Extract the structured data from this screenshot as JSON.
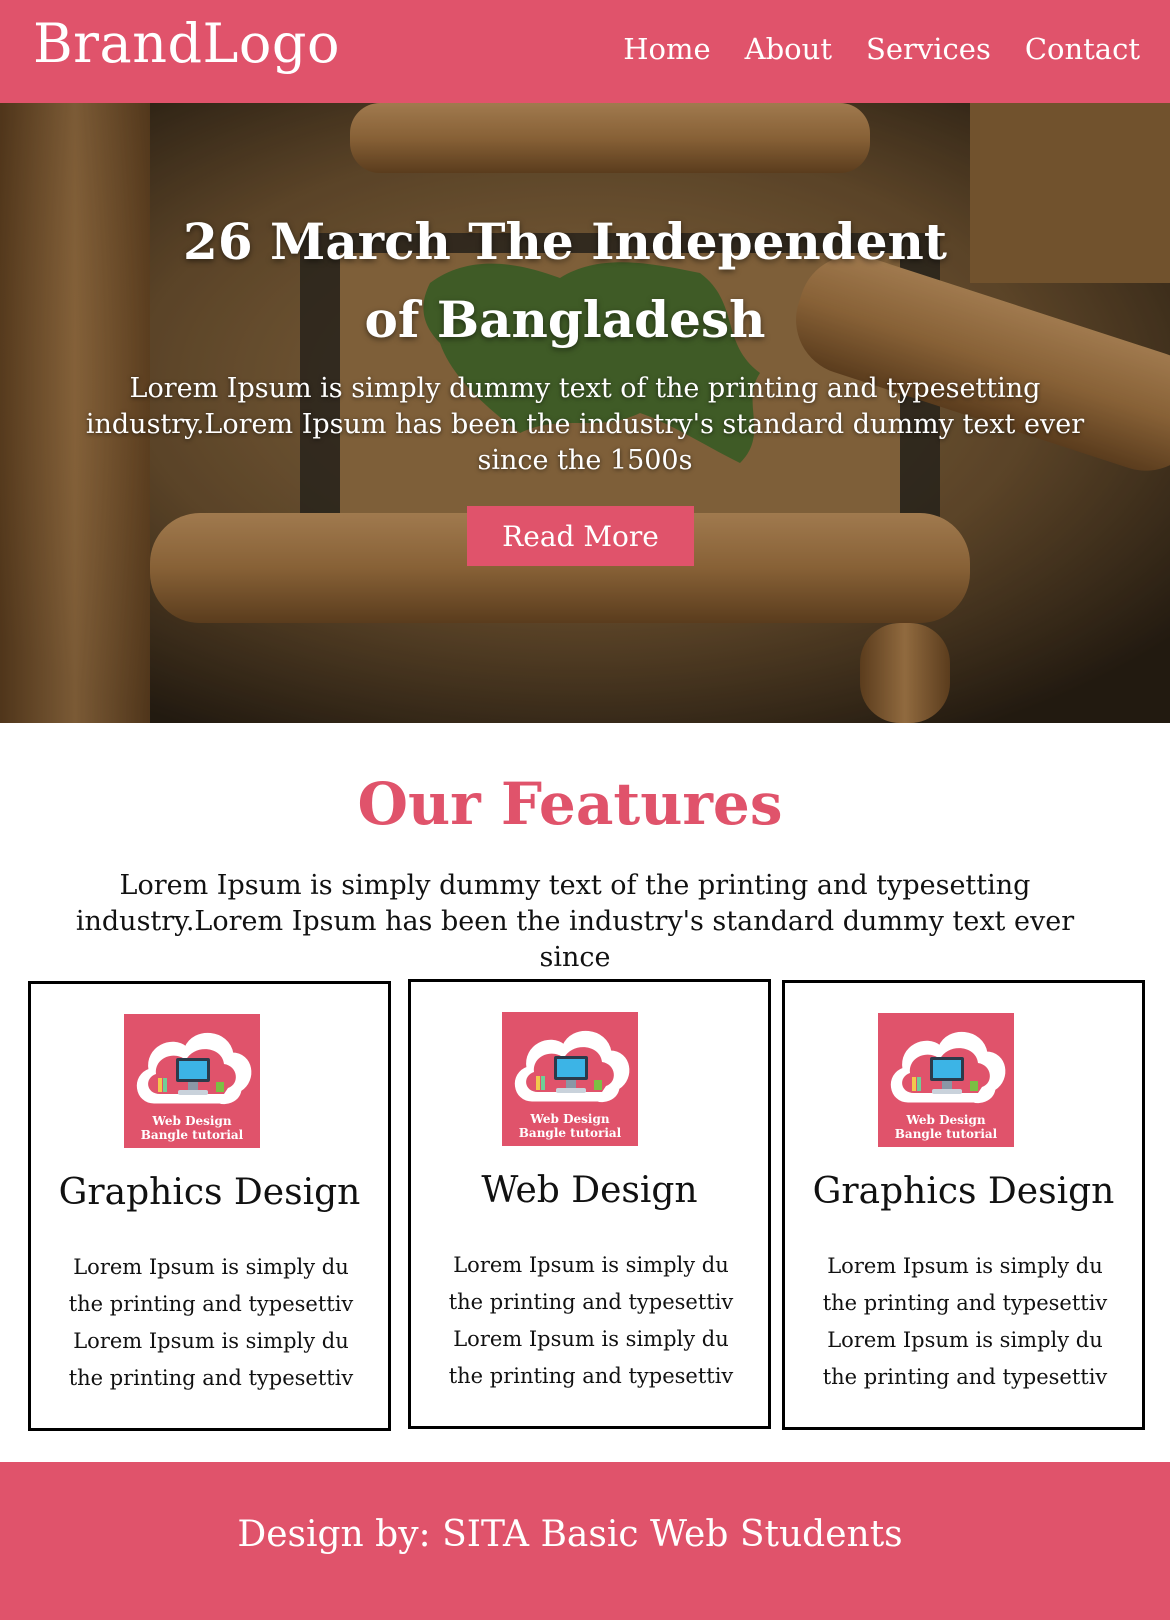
{
  "header": {
    "brand": "BrandLogo",
    "nav": [
      "Home",
      "About",
      "Services",
      "Contact"
    ]
  },
  "hero": {
    "title_line1": "26 March The Independent",
    "title_line2": "of Bangladesh",
    "text": "Lorem Ipsum is simply dummy text of the printing and typesetting industry.Lorem Ipsum has been the industry's standard dummy text ever since the 1500s",
    "button": "Read More"
  },
  "features": {
    "title": "Our Features",
    "text_line1": "Lorem Ipsum is simply dummy text of the printing and typesetting",
    "text_line2": "industry.Lorem Ipsum has been the industry's standard dummy text ever since",
    "cards": [
      {
        "logo_line1": "Web Design",
        "logo_line2": "Bangle tutorial",
        "title": "Graphics Design",
        "lines": [
          "Lorem Ipsum is simply du",
          "the printing and typesettiv",
          "Lorem Ipsum is simply du",
          "the printing and typesettiv"
        ]
      },
      {
        "logo_line1": "Web Design",
        "logo_line2": "Bangle tutorial",
        "title": "Web Design",
        "lines": [
          "Lorem Ipsum is simply du",
          "the printing and typesettiv",
          "Lorem Ipsum is simply du",
          "the printing and typesettiv"
        ]
      },
      {
        "logo_line1": "Web Design",
        "logo_line2": "Bangle tutorial",
        "title": "Graphics Design",
        "lines": [
          "Lorem Ipsum is simply du",
          "the printing and typesettiv",
          "Lorem Ipsum is simply du",
          "the printing and typesettiv"
        ]
      }
    ]
  },
  "footer": {
    "text": "Design by: SITA Basic Web Students"
  },
  "colors": {
    "accent": "#e0536b",
    "text": "#111111",
    "background": "#ffffff"
  }
}
